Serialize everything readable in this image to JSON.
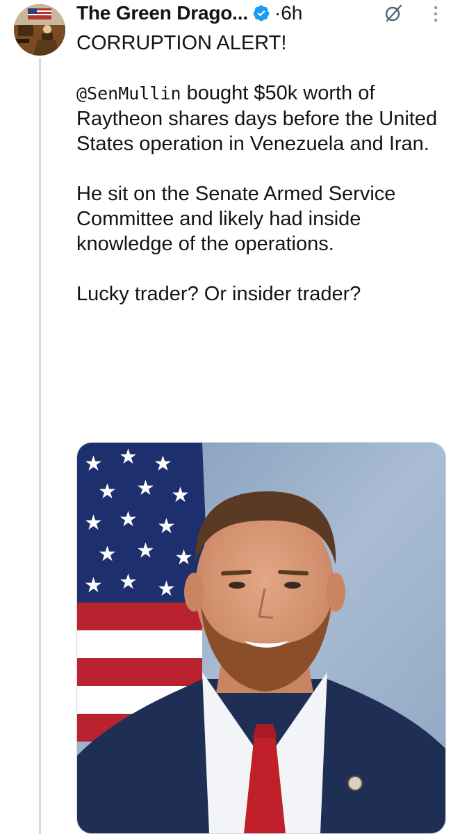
{
  "author": {
    "name": "The Green Drago...",
    "time": "6h",
    "separator": "·"
  },
  "tweet": {
    "line1": "CORRUPTION ALERT!",
    "mention": "@SenMullin",
    "para1_rest": " bought $50k worth of Raytheon shares days before the United States operation in Venezuela and Iran.",
    "para2": "He sit on the Senate Armed Service Committee and likely had inside knowledge of the operations.",
    "para3": "Lucky trader? Or insider trader?"
  },
  "icons": {
    "verified": "verified-badge-icon",
    "grok": "grok-icon",
    "more": "more-vertical-icon"
  },
  "colors": {
    "verified_blue": "#1d9bf0",
    "text": "#0f1419",
    "thread_line": "#cfd9de"
  }
}
